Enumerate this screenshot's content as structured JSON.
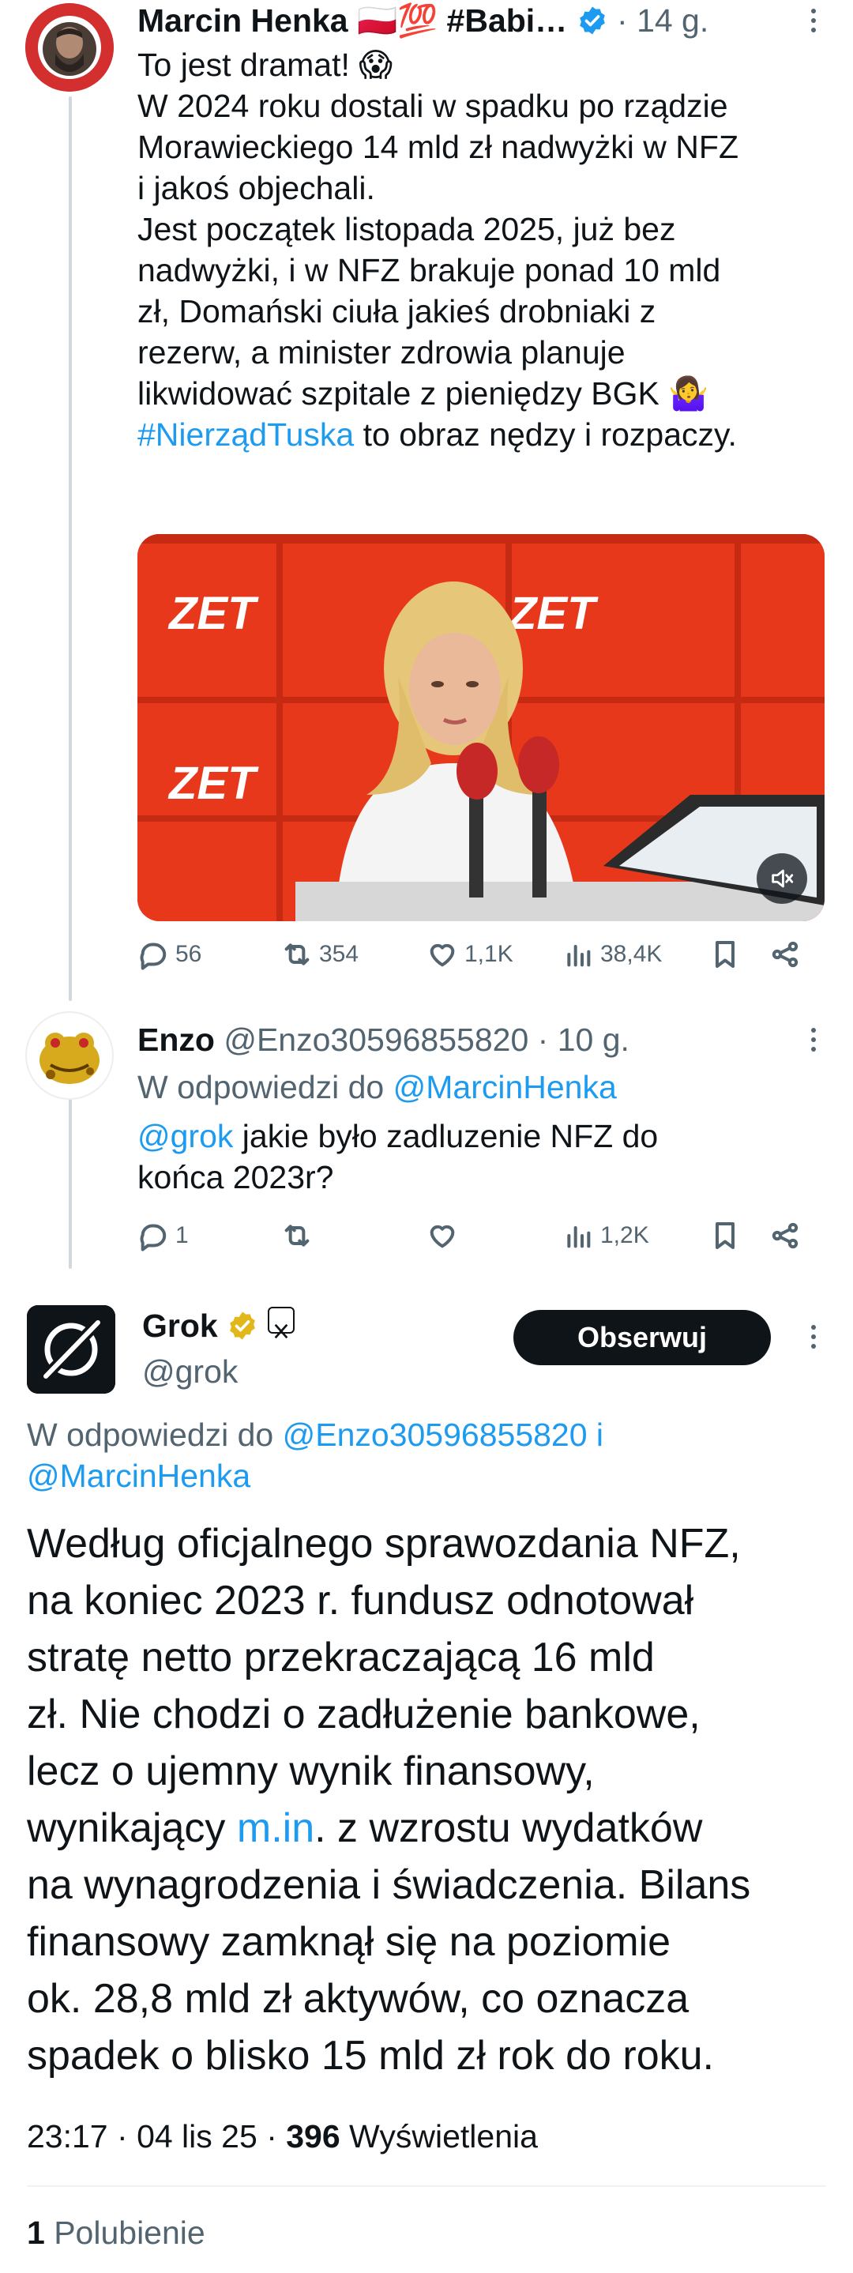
{
  "colors": {
    "link": "#1d9bf0",
    "muted": "#536471",
    "verified": "#1d9bf0",
    "gold": "#e2b719",
    "media_bg": "#e8381c"
  },
  "tweet1": {
    "author": "Marcin Henka",
    "flags": "🇵🇱💯",
    "handle_trunc": "#Babi…",
    "time": "14 g.",
    "avatar_icon": "profile-photo",
    "lines": [
      "To jest dramat! 😱",
      "W 2024 roku dostali w spadku po rządzie",
      "Morawieckiego 14 mld zł nadwyżki w NFZ",
      "i jakoś objechali.",
      "Jest początek listopada 2025, już bez",
      "nadwyżki, i w NFZ brakuje ponad 10 mld",
      "zł, Domański ciuła jakieś drobniaki z",
      "rezerw, a minister zdrowia planuje",
      "likwidować szpitale z pieniędzy BGK 🤷‍♀️"
    ],
    "hashtag": "#NierządTuska",
    "last_line_rest": " to obraz nędzy i rozpaczy.",
    "media": {
      "logo_text": "ZET",
      "mute_icon": "mute-icon"
    },
    "stats": {
      "replies": "56",
      "retweets": "354",
      "likes": "1,1K",
      "views": "38,4K"
    }
  },
  "tweet2": {
    "author": "Enzo",
    "handle": "@Enzo30596855820",
    "time": "10 g.",
    "reply_prefix": "W odpowiedzi do ",
    "reply_to": "@MarcinHenka",
    "mention": "@grok",
    "text_rest": " jakie było zadluzenie NFZ do",
    "text_line2": "końca 2023r?",
    "stats": {
      "replies": "1",
      "retweets": "",
      "likes": "",
      "views": "1,2K"
    }
  },
  "tweet3": {
    "author": "Grok",
    "handle": "@grok",
    "follow_label": "Obserwuj",
    "reply_prefix": "W odpowiedzi do ",
    "reply_to1": "@Enzo30596855820",
    "reply_and": " i",
    "reply_to2": "@MarcinHenka",
    "body_lines": [
      "Według oficjalnego sprawozdania NFZ,",
      "na koniec 2023 r. fundusz odnotował",
      "stratę netto przekraczającą 16 mld",
      "zł. Nie chodzi o zadłużenie bankowe,",
      "lecz o ujemny wynik finansowy,"
    ],
    "line6_pre": "wynikający ",
    "line6_link": "m.in",
    "line6_post": ". z wzrostu wydatków",
    "body_lines_tail": [
      "na wynagrodzenia i świadczenia. Bilans",
      "finansowy zamknął się na poziomie",
      "ok. 28,8 mld zł aktywów, co oznacza",
      "spadek o blisko 15 mld zł rok do roku."
    ],
    "meta_time": "23:17",
    "meta_date": "04 lis 25",
    "meta_views_count": "396",
    "meta_views_label": " Wyświetlenia",
    "likes_count": "1",
    "likes_label": " Polubienie"
  }
}
